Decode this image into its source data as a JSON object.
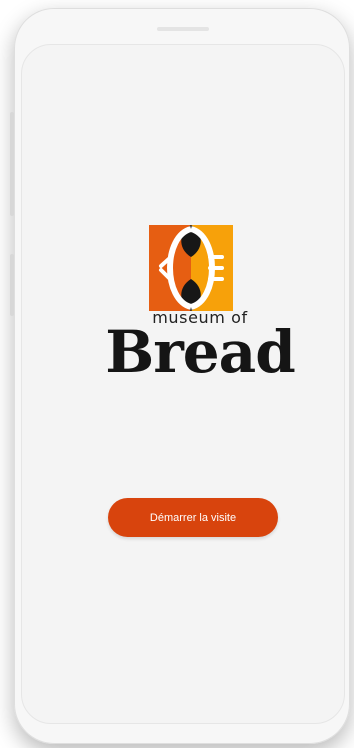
{
  "app": {
    "logo": {
      "subtitle": "museum of",
      "title": "Bread"
    },
    "start_button": {
      "label": "Démarrer la visite"
    }
  },
  "colors": {
    "accent": "#d8440d",
    "logo_orange": "#e65e12",
    "logo_amber": "#f7a10a",
    "logo_dark": "#171717"
  }
}
